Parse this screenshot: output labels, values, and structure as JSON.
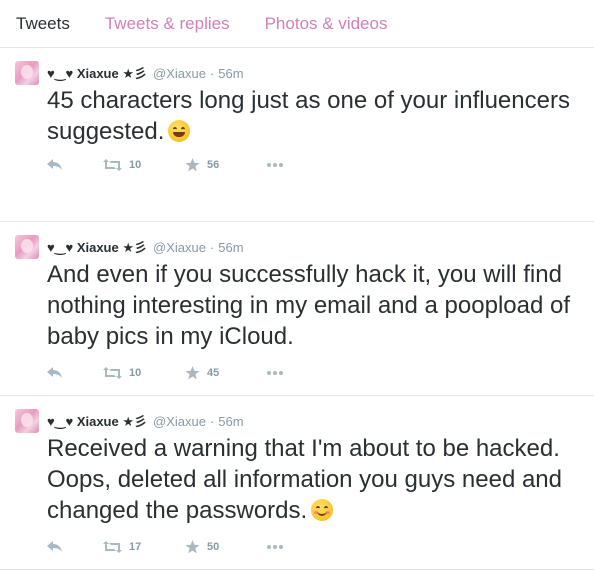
{
  "tabs": [
    {
      "label": "Tweets",
      "active": true
    },
    {
      "label": "Tweets & replies",
      "active": false
    },
    {
      "label": "Photos & videos",
      "active": false
    }
  ],
  "tweets": [
    {
      "name": "♥‿♥ Xiaxue ★彡",
      "handle": "@Xiaxue",
      "dot": "·",
      "time": "56m",
      "text": "45 characters long just as one of your influencers suggested.",
      "emoji": "grinning-face",
      "retweets": "10",
      "favorites": "56"
    },
    {
      "name": "♥‿♥ Xiaxue ★彡",
      "handle": "@Xiaxue",
      "dot": "·",
      "time": "56m",
      "text": "And even if you successfully hack it, you will find nothing interesting in my email and a poopload of baby pics in my iCloud.",
      "emoji": "",
      "retweets": "10",
      "favorites": "45"
    },
    {
      "name": "♥‿♥ Xiaxue ★彡",
      "handle": "@Xiaxue",
      "dot": "·",
      "time": "56m",
      "text": "Received a warning that I'm about to be hacked. Oops, deleted all information you guys need and changed the passwords.",
      "emoji": "smiling-face-blush",
      "retweets": "17",
      "favorites": "50"
    }
  ],
  "colors": {
    "active_tab": "#292f33",
    "inactive_tab": "#d37fb8",
    "muted": "#8899a6",
    "icon": "#aab8c2",
    "divider": "#e1e8ed"
  }
}
